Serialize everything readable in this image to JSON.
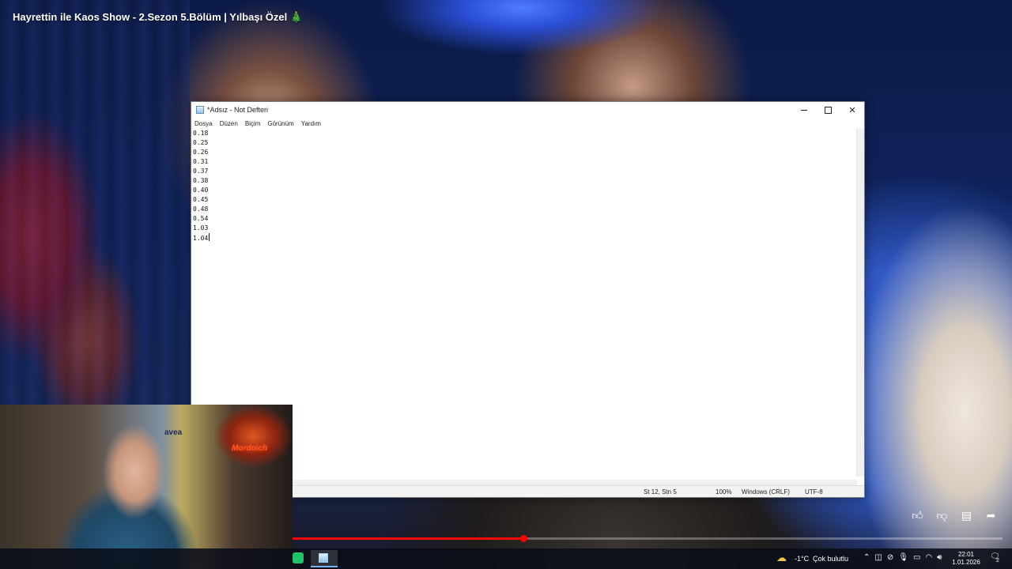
{
  "video": {
    "title": "Hayrettin ile Kaos Show - 2.Sezon 5.Bölüm | Yılbaşı Özel",
    "title_emoji": "🎄",
    "progress_fraction": 0.325
  },
  "notepad": {
    "title": "*Adsız - Not Defteri",
    "menu": [
      "Dosya",
      "Düzen",
      "Biçim",
      "Görünüm",
      "Yardım"
    ],
    "lines": [
      "0.18",
      "0.25",
      "0.26",
      "0.31",
      "0.37",
      "0.38",
      "0.40",
      "0.45",
      "0.48",
      "0.54",
      "1.03",
      "1.04"
    ],
    "status": {
      "position": "St 12, Stn 5",
      "zoom": "100%",
      "line_ending": "Windows (CRLF)",
      "encoding": "UTF-8"
    }
  },
  "webcam": {
    "jersey_text": "avea",
    "brand_text": "Mordoich"
  },
  "player": {
    "icons": [
      "like-icon",
      "dislike-icon",
      "comment-icon",
      "share-icon"
    ]
  },
  "taskbar": {
    "temperature": "-1°C",
    "weather": "Çok bulutlu",
    "time": "22:01",
    "date": "1.01.2026",
    "notification_count": "2"
  }
}
